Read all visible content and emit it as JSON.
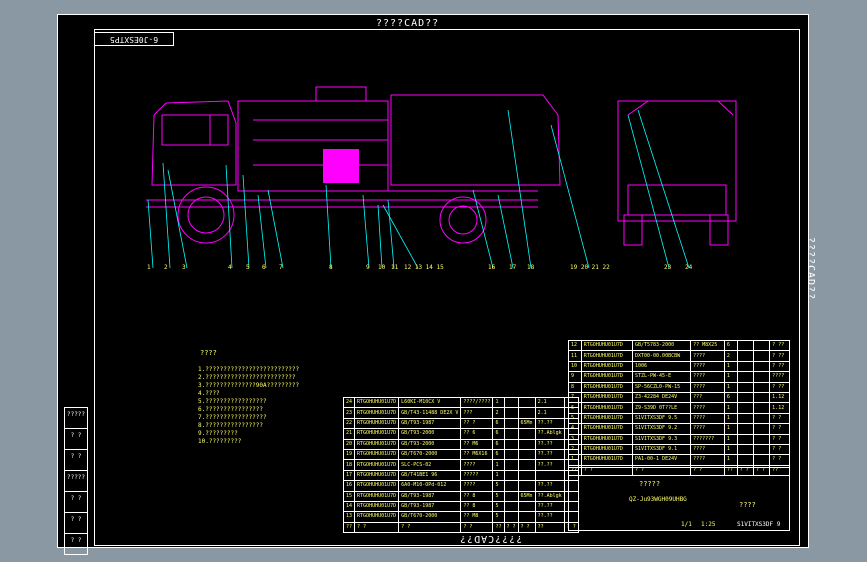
{
  "stamps": {
    "top": "????CAD??",
    "bottom": "????CAD??",
    "right": "????CAD??"
  },
  "drawing_code": "6-J0ESXTP5",
  "balloons": [
    "1",
    "2",
    "3",
    "4",
    "5",
    "6",
    "7",
    "8",
    "9",
    "10",
    "11",
    "12 13 14 15",
    "16",
    "17",
    "18",
    "19 20 21 22",
    "23",
    "24"
  ],
  "notes": {
    "title": "????",
    "lines": [
      "1.??????????????????????????",
      "2.?????????????????????????",
      "3.??????????????90A?????????",
      "4.????",
      "5.?????????????????",
      "6.????????????????",
      "7.?????????????????",
      "8.????????????????",
      "9.?????????",
      "10.?????????"
    ]
  },
  "side_strip": [
    "?????",
    "? ?",
    "? ?",
    "?????",
    "? ?",
    "? ?",
    "? ?"
  ],
  "bom_left": [
    [
      "24",
      "RTGOHUHU01U7D",
      "L60KI-M10CX V",
      "????/????",
      "1",
      "",
      "",
      "2.1",
      ""
    ],
    [
      "23",
      "RTGOHUHU01U7D",
      "GB/T43-11488 DE2X V",
      "???",
      "2",
      "",
      "",
      "2.1",
      ""
    ],
    [
      "22",
      "RTGOHUHU01U7D",
      "GB/T93-1987",
      "??  ?",
      "6",
      "",
      "65Mn",
      "??.??",
      ""
    ],
    [
      "21",
      "RTGOHUHU01U7D",
      "GB/T93-2000",
      "?? 6",
      "6",
      "",
      "",
      "??.Ablgk",
      ""
    ],
    [
      "20",
      "RTGOHUHU01U7D",
      "GB/T93-2000",
      "?? M6",
      "6",
      "",
      "",
      "??.??",
      ""
    ],
    [
      "19",
      "RTGOHUHU01U7D",
      "GB/T670-2000",
      "?? M6X16",
      "6",
      "",
      "",
      "??.??",
      ""
    ],
    [
      "18",
      "RTGOHUHU01U7D",
      "SLC-PCS-02",
      "????",
      "1",
      "",
      "",
      "??.??",
      ""
    ],
    [
      "17",
      "RTGOHUHU01U7D",
      "GB/T41BE1 96",
      "?????",
      "1",
      "",
      "",
      "",
      ""
    ],
    [
      "16",
      "RTGOHUHU01U7D",
      "6A0-M10-OPd-012",
      "????",
      "5",
      "",
      "",
      "??.??",
      ""
    ],
    [
      "15",
      "RTGOHUHU01U7D",
      "GB/T93-1987",
      "?? 8",
      "5",
      "",
      "65Mn",
      "??.Ablgk",
      ""
    ],
    [
      "14",
      "RTGOHUHU01U7D",
      "GB/T93-1987",
      "?? 8",
      "5",
      "",
      "",
      "??.??",
      ""
    ],
    [
      "13",
      "RTGOHUHU01U7D",
      "GB/T670-2000",
      "?? M8",
      "5",
      "",
      "",
      "??.??",
      ""
    ],
    [
      "??",
      "? ?",
      "? ?",
      "? ?",
      "??",
      "? ?",
      "? ?",
      "??",
      "? ?"
    ]
  ],
  "bom_right": [
    [
      "12",
      "RTGOHUHU01U7D",
      "GB/T5783-2000",
      "?? M8X25",
      "6",
      "",
      "",
      "? ??"
    ],
    [
      "11",
      "RTGOHUHU01U7D",
      "DXT00-00.00BCBW",
      "????",
      "2",
      "",
      "",
      "? ??"
    ],
    [
      "10",
      "RTGOHUHU01U7D",
      "1006",
      "????",
      "1",
      "",
      "",
      "? ??"
    ],
    [
      "9",
      "RTGOHUHU01U7D",
      "STZL-PW-45-E",
      "????",
      "1",
      "",
      "",
      "????"
    ],
    [
      "8",
      "RTGOHUHU01U7D",
      "SP-56CZL0-PW-15",
      "????",
      "1",
      "",
      "",
      "? ??"
    ],
    [
      "7",
      "RTGOHUHU01U7D",
      "Z3-42284 DE24V",
      "???",
      "6",
      "",
      "",
      "1.12"
    ],
    [
      "6",
      "RTGOHUHU01U7D",
      "Z9-S39D 0T??LE",
      "????",
      "1",
      "",
      "",
      "1.12"
    ],
    [
      "5",
      "RTGOHUHU01U7D",
      "S1VITXS3DF 9.5",
      "????",
      "1",
      "",
      "",
      "? ?"
    ],
    [
      "4",
      "RTGOHUHU01U7D",
      "S1VITXS3DF 9.2",
      "????",
      "1",
      "",
      "",
      "? ?"
    ],
    [
      "3",
      "RTGOHUHU01U7D",
      "S1VITXS3DF 9.3",
      "???????",
      "1",
      "",
      "",
      "? ?"
    ],
    [
      "2",
      "RTGOHUHU01U7D",
      "S1VITXS3DF 9.1",
      "????",
      "1",
      "",
      "",
      "? ?"
    ],
    [
      "1",
      "RTGOHUHU01U7D",
      "PA1-00-1 DE24V",
      "????",
      "1",
      "",
      "",
      "? ?"
    ],
    [
      "??",
      "? ?",
      "? ?",
      "? ?",
      "??",
      "? ?",
      "? ?",
      "??"
    ]
  ],
  "title_block": {
    "company": "?????",
    "part_no": "QZ-Ju93WGH09UHBG",
    "drawing_title": "????",
    "drawing_code": "S1VITXS3DF 9",
    "scale": "1:25",
    "sheet": "1/1"
  },
  "colors": {
    "line": "#00ffff",
    "truck": "#ff00ff",
    "text": "#ffff66",
    "frame": "#ffffff",
    "fill": "#ff00ff"
  }
}
